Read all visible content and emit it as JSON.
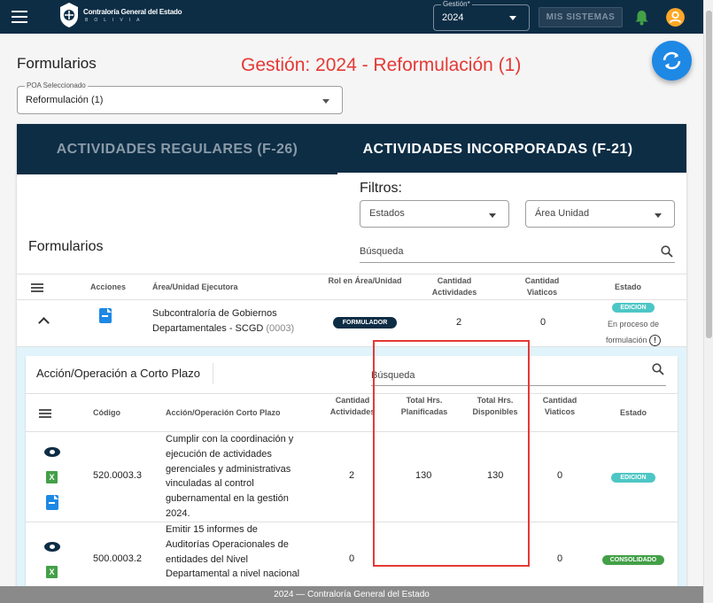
{
  "topbar": {
    "logo_text": "Contraloría General del Estado",
    "logo_sub": "BOLIVIA",
    "gestion_label": "Gestión*",
    "gestion_value": "2024",
    "mis_sistemas_label": "MIS SISTEMAS",
    "colors": {
      "bar": "#0d2d45",
      "bell": "#43a047",
      "user": "#ffa726"
    }
  },
  "page": {
    "title": "Formularios",
    "gestion_heading": "Gestión: 2024 - Reformulación (1)",
    "poa_label": "POA Seleccionado",
    "poa_value": "Reformulación (1)"
  },
  "tabs": [
    {
      "label": "ACTIVIDADES REGULARES (F-26)",
      "active": false
    },
    {
      "label": "ACTIVIDADES INCORPORADAS (F-21)",
      "active": true
    }
  ],
  "filters": {
    "title": "Filtros:",
    "estados_label": "Estados",
    "area_label": "Área Unidad",
    "search_placeholder": "Búsqueda"
  },
  "section_title": "Formularios",
  "table": {
    "headers": {
      "acciones": "Acciones",
      "area": "Área/Unidad Ejecutora",
      "rol": "Rol en Área/Unidad",
      "cant_act_1": "Cantidad",
      "cant_act_2": "Actividades",
      "cant_via_1": "Cantidad",
      "cant_via_2": "Viaticos",
      "estado": "Estado"
    },
    "rows": [
      {
        "area_1": "Subcontraloría de Gobiernos",
        "area_2": "Departamentales - SCGD",
        "area_code": "(0003)",
        "rol": "FORMULADOR",
        "actividades": "2",
        "viaticos": "0",
        "estado_badge": "EDICION",
        "estado_1": "En proceso de",
        "estado_2": "formulación"
      }
    ]
  },
  "inner": {
    "title": "Acción/Operación a Corto Plazo",
    "search_placeholder": "Búsqueda",
    "headers": {
      "codigo": "Código",
      "accion": "Acción/Operación Corto Plazo",
      "cant_act_1": "Cantidad",
      "cant_act_2": "Actividades",
      "total_plan_1": "Total Hrs.",
      "total_plan_2": "Planificadas",
      "total_disp_1": "Total Hrs.",
      "total_disp_2": "Disponibles",
      "cant_via_1": "Cantidad",
      "cant_via_2": "Viaticos",
      "estado": "Estado"
    },
    "rows": [
      {
        "codigo": "520.0003.3",
        "desc": [
          "Cumplir con la coordinación y",
          "ejecución de actividades",
          "gerenciales y administrativas",
          "vinculadas al control",
          "gubernamental en la gestión",
          "2024."
        ],
        "actividades": "2",
        "planificadas": "130",
        "disponibles": "130",
        "viaticos": "0",
        "estado": "EDICION"
      },
      {
        "codigo": "500.0003.2",
        "desc": [
          "Emitir 15 informes de",
          "Auditorías Operacionales de",
          "entidades del Nivel",
          "Departamental a nivel nacional"
        ],
        "actividades": "0",
        "viaticos": "0",
        "estado": "CONSOLIDADO"
      }
    ]
  },
  "footer": "2024 — Contraloría General del Estado"
}
